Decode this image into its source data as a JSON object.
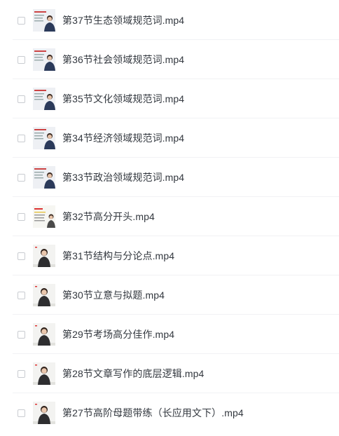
{
  "files": [
    {
      "name": "第37节生态领域规范词.mp4",
      "thumb": "lecture-slide-presenter"
    },
    {
      "name": "第36节社会领域规范词.mp4",
      "thumb": "lecture-slide-presenter"
    },
    {
      "name": "第35节文化领域规范词.mp4",
      "thumb": "lecture-slide-presenter"
    },
    {
      "name": "第34节经济领域规范词.mp4",
      "thumb": "lecture-slide-presenter"
    },
    {
      "name": "第33节政治领域规范词.mp4",
      "thumb": "lecture-slide-presenter"
    },
    {
      "name": "第32节高分开头.mp4",
      "thumb": "lecture-text-presenter"
    },
    {
      "name": "第31节结构与分论点.mp4",
      "thumb": "lecture-presenter"
    },
    {
      "name": "第30节立意与拟题.mp4",
      "thumb": "lecture-presenter"
    },
    {
      "name": "第29节考场高分佳作.mp4",
      "thumb": "lecture-presenter"
    },
    {
      "name": "第28节文章写作的底层逻辑.mp4",
      "thumb": "lecture-presenter"
    },
    {
      "name": "第27节高阶母题带练（长应用文下）.mp4",
      "thumb": "lecture-presenter"
    }
  ],
  "colors": {
    "text": "#33383f",
    "divider": "#f1f2f4",
    "checkbox_border": "#c9ccd1"
  }
}
